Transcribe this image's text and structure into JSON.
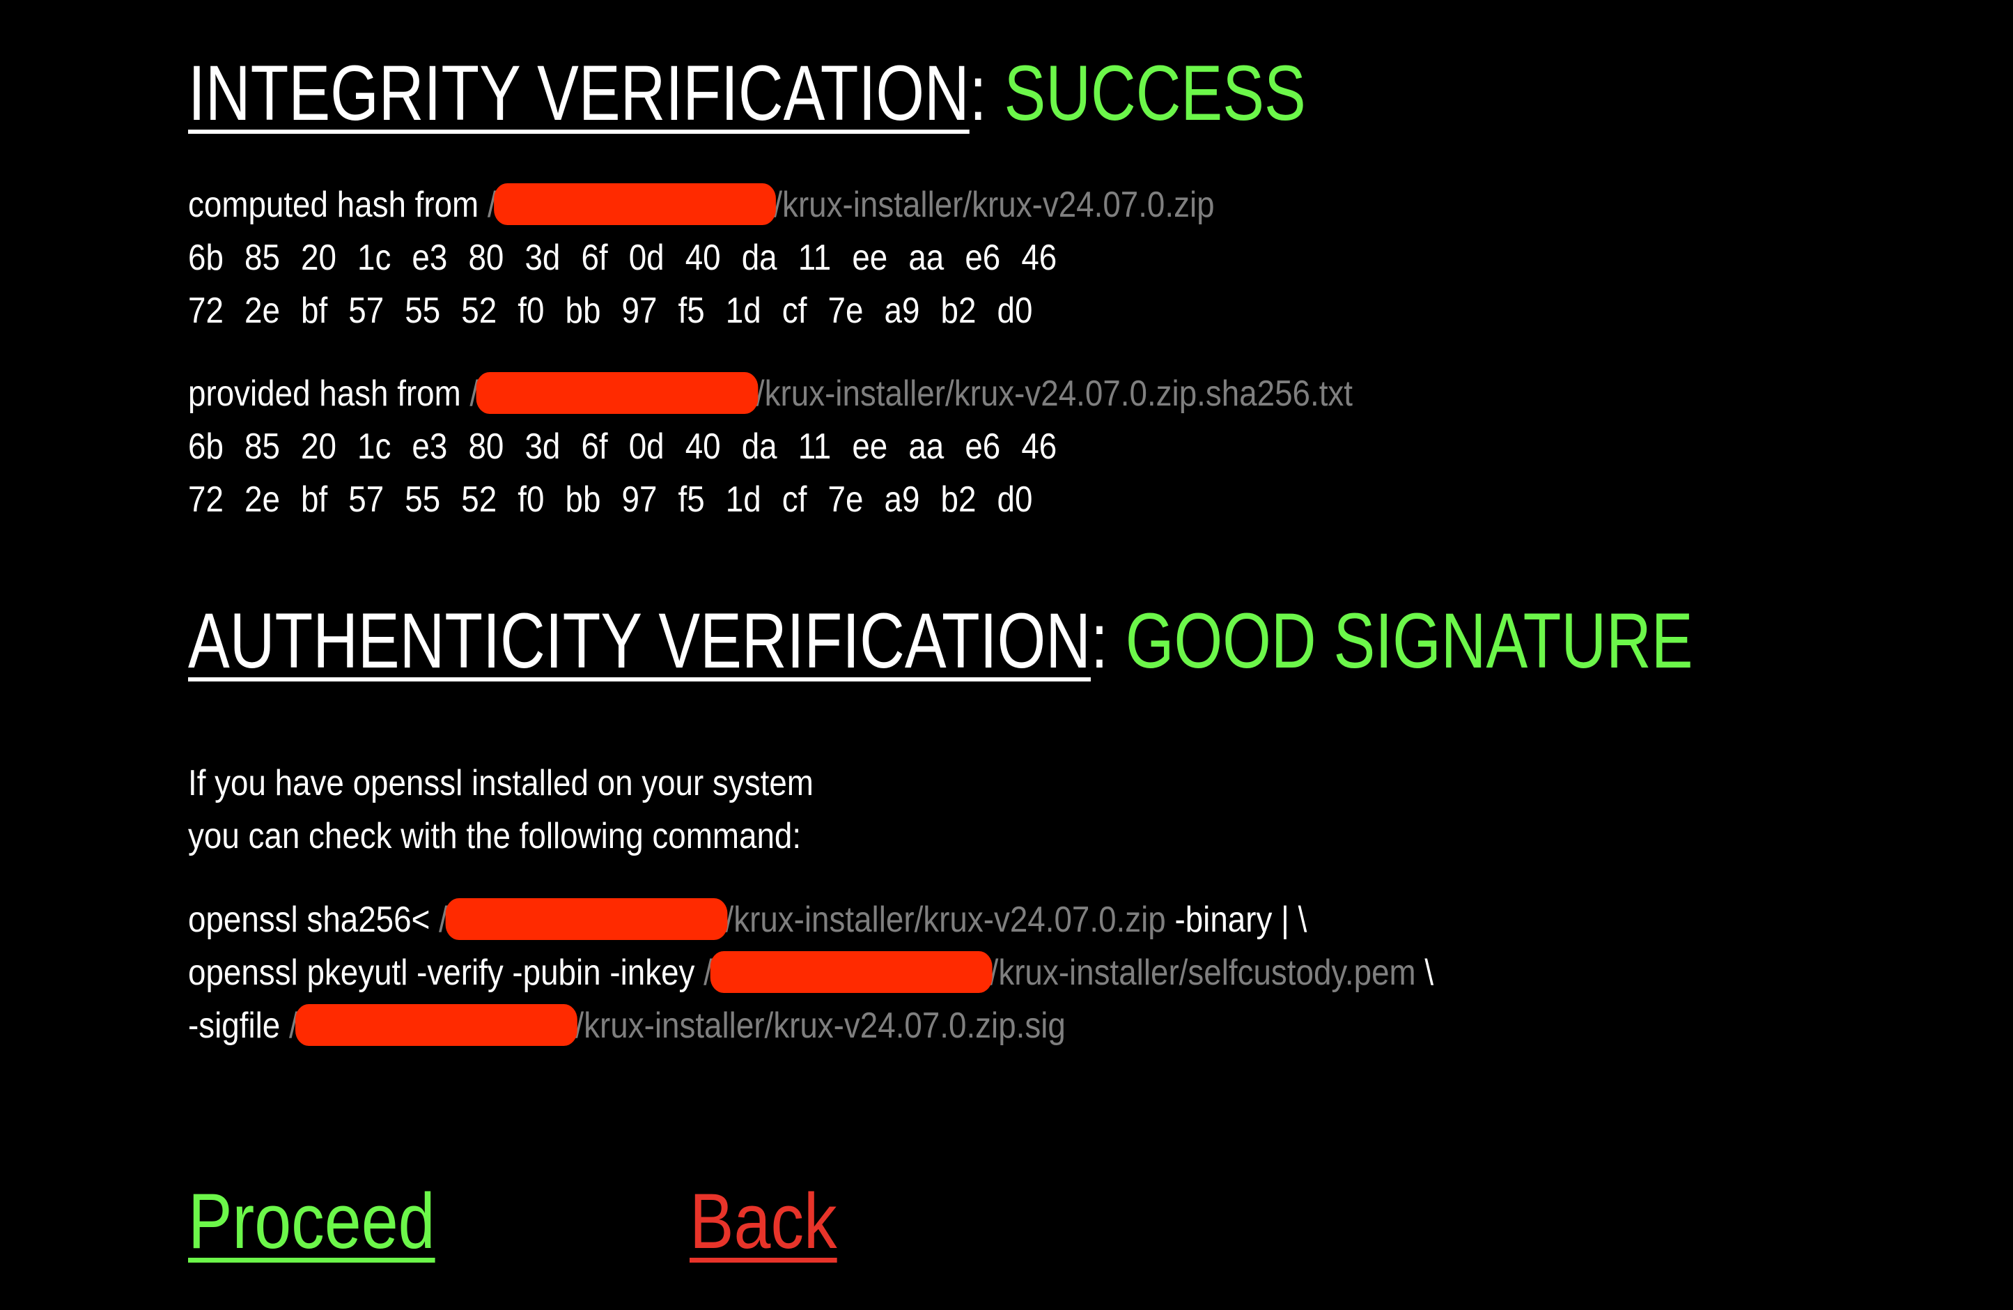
{
  "colors": {
    "background": "#000000",
    "text": "#ffffff",
    "path_text": "#7f7f7f",
    "success": "#6cf74a",
    "back": "#e8342a",
    "redaction": "#ff2a00"
  },
  "integrity": {
    "title": "INTEGRITY VERIFICATION",
    "separator": ":",
    "status": "SUCCESS",
    "computed": {
      "label": "computed hash from",
      "path_prefix": "/",
      "path_suffix": "/krux-installer/krux-v24.07.0.zip",
      "hash_line_1": "6b 85 20 1c e3 80 3d 6f 0d 40 da 11 ee aa e6 46",
      "hash_line_2": "72 2e bf 57 55 52 f0 bb 97 f5 1d cf 7e a9 b2 d0"
    },
    "provided": {
      "label": "provided hash from",
      "path_prefix": "/",
      "path_suffix": "/krux-installer/krux-v24.07.0.zip.sha256.txt",
      "hash_line_1": "6b 85 20 1c e3 80 3d 6f 0d 40 da 11 ee aa e6 46",
      "hash_line_2": "72 2e bf 57 55 52 f0 bb 97 f5 1d cf 7e a9 b2 d0"
    }
  },
  "authenticity": {
    "title": "AUTHENTICITY VERIFICATION",
    "separator": ":",
    "status": "GOOD SIGNATURE",
    "instructions_line_1": "If you have openssl installed on your system",
    "instructions_line_2": "you can check with the following command:",
    "command": {
      "line_1": {
        "prefix": "openssl sha256<",
        "path_prefix": "/",
        "path_suffix": "/krux-installer/krux-v24.07.0.zip",
        "suffix": "-binary | \\"
      },
      "line_2": {
        "prefix": "openssl pkeyutl -verify -pubin -inkey",
        "path_prefix": "/",
        "path_suffix": "/krux-installer/selfcustody.pem",
        "suffix": "\\"
      },
      "line_3": {
        "prefix": "-sigfile",
        "path_prefix": "/",
        "path_suffix": "/krux-installer/krux-v24.07.0.zip.sig"
      }
    }
  },
  "actions": {
    "proceed_label": "Proceed",
    "back_label": "Back"
  }
}
